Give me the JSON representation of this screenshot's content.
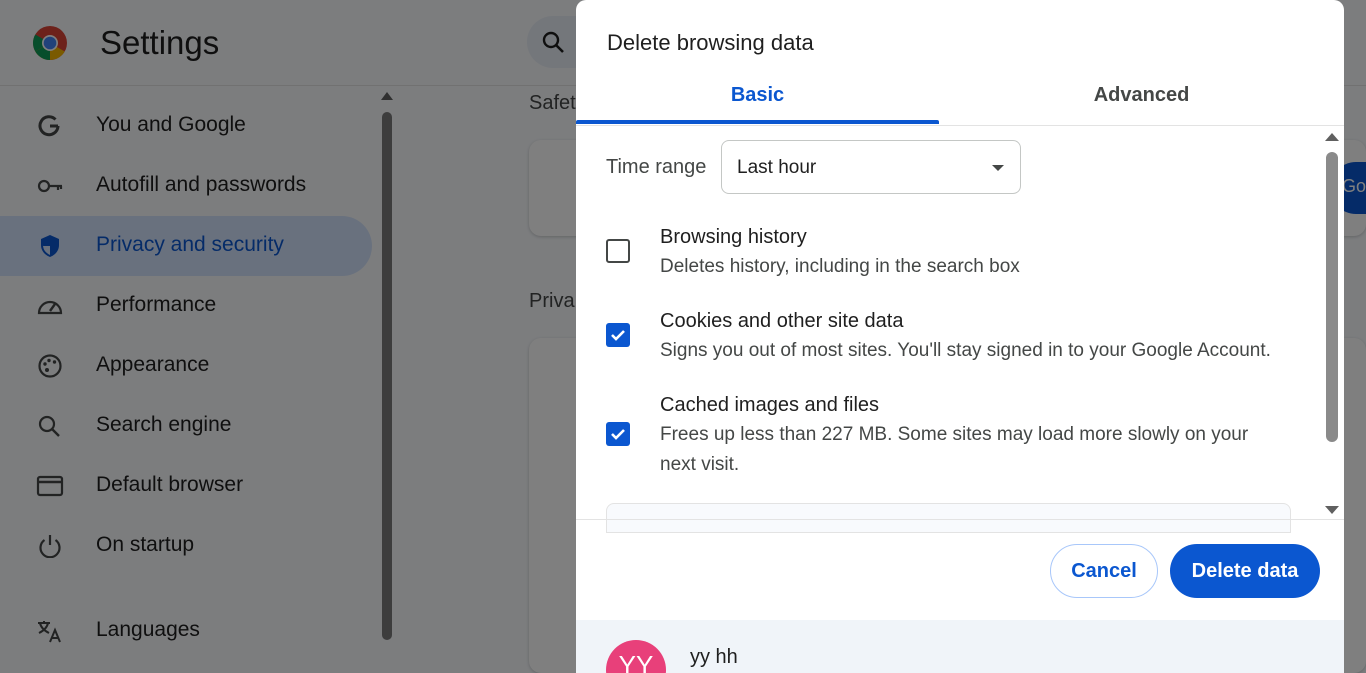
{
  "app": {
    "title": "Settings"
  },
  "sidebar": {
    "items": [
      {
        "label": "You and Google",
        "icon": "google-g-icon"
      },
      {
        "label": "Autofill and passwords",
        "icon": "key-icon"
      },
      {
        "label": "Privacy and security",
        "icon": "shield-icon",
        "active": true
      },
      {
        "label": "Performance",
        "icon": "speedometer-icon"
      },
      {
        "label": "Appearance",
        "icon": "palette-icon"
      },
      {
        "label": "Search engine",
        "icon": "search-icon"
      },
      {
        "label": "Default browser",
        "icon": "browser-window-icon"
      },
      {
        "label": "On startup",
        "icon": "power-icon"
      },
      {
        "label": "Languages",
        "icon": "translate-icon"
      }
    ]
  },
  "content": {
    "safety_heading": "Safet",
    "privacy_heading": "Priva",
    "go_button": "Go"
  },
  "dialog": {
    "title": "Delete browsing data",
    "tabs": [
      {
        "label": "Basic",
        "selected": true
      },
      {
        "label": "Advanced",
        "selected": false
      }
    ],
    "time_range": {
      "label": "Time range",
      "value": "Last hour"
    },
    "options": [
      {
        "title": "Browsing history",
        "description": "Deletes history, including in the search box",
        "checked": false
      },
      {
        "title": "Cookies and other site data",
        "description": "Signs you out of most sites. You'll stay signed in to your Google Account.",
        "checked": true
      },
      {
        "title": "Cached images and files",
        "description": "Frees up less than 227 MB. Some sites may load more slowly on your next visit.",
        "checked": true
      }
    ],
    "cancel_label": "Cancel",
    "delete_label": "Delete data",
    "account": {
      "initials": "YY",
      "name": "yy hh"
    }
  },
  "colors": {
    "accent": "#0b57d0",
    "active_nav_bg": "#d3e3fd",
    "avatar": "#e8407a"
  }
}
